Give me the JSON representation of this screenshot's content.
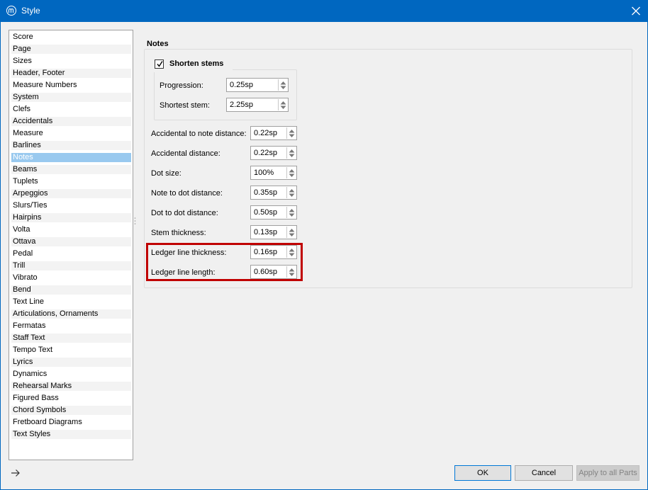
{
  "window": {
    "title": "Style"
  },
  "sidebar": {
    "items": [
      "Score",
      "Page",
      "Sizes",
      "Header, Footer",
      "Measure Numbers",
      "System",
      "Clefs",
      "Accidentals",
      "Measure",
      "Barlines",
      "Notes",
      "Beams",
      "Tuplets",
      "Arpeggios",
      "Slurs/Ties",
      "Hairpins",
      "Volta",
      "Ottava",
      "Pedal",
      "Trill",
      "Vibrato",
      "Bend",
      "Text Line",
      "Articulations, Ornaments",
      "Fermatas",
      "Staff Text",
      "Tempo Text",
      "Lyrics",
      "Dynamics",
      "Rehearsal Marks",
      "Figured Bass",
      "Chord Symbols",
      "Fretboard Diagrams",
      "Text Styles"
    ],
    "selected": "Notes"
  },
  "notes": {
    "section_title": "Notes",
    "shorten_stems": {
      "label": "Shorten stems",
      "checked": true
    },
    "progression": {
      "label": "Progression:",
      "value": "0.25sp"
    },
    "shortest_stem": {
      "label": "Shortest stem:",
      "value": "2.25sp"
    },
    "accidental_note_distance": {
      "label": "Accidental to note distance:",
      "value": "0.22sp"
    },
    "accidental_distance": {
      "label": "Accidental distance:",
      "value": "0.22sp"
    },
    "dot_size": {
      "label": "Dot size:",
      "value": "100%"
    },
    "note_dot_distance": {
      "label": "Note to dot distance:",
      "value": "0.35sp"
    },
    "dot_dot_distance": {
      "label": "Dot to dot distance:",
      "value": "0.50sp"
    },
    "stem_thickness": {
      "label": "Stem thickness:",
      "value": "0.13sp"
    },
    "ledger_line_thickness": {
      "label": "Ledger line thickness:",
      "value": "0.16sp"
    },
    "ledger_line_length": {
      "label": "Ledger line length:",
      "value": "0.60sp"
    }
  },
  "footer": {
    "ok_label": "OK",
    "cancel_label": "Cancel",
    "apply_all_label": "Apply to all Parts"
  },
  "colors": {
    "titlebar": "#0067c0",
    "selection": "#99c9ef",
    "highlight_box": "#c00000"
  }
}
